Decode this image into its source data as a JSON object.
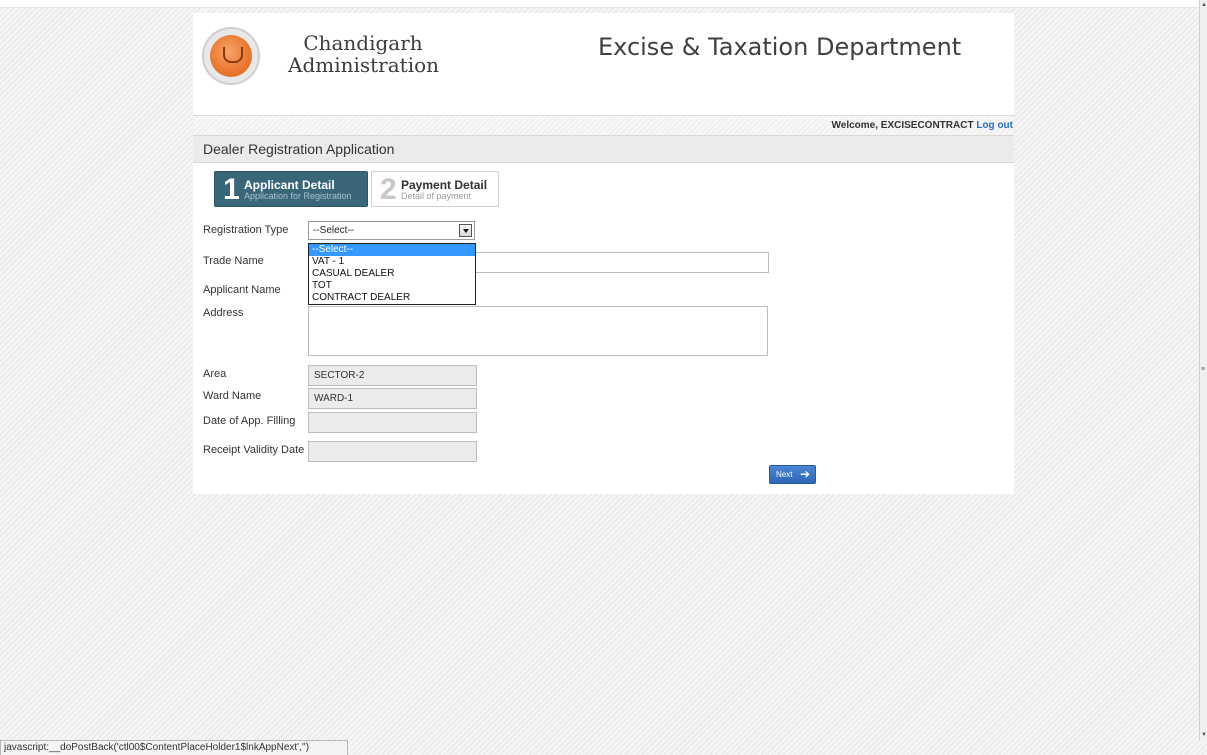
{
  "header": {
    "brand_line1": "Chandigarh",
    "brand_line2": "Administration",
    "department": "Excise & Taxation Department"
  },
  "user_bar": {
    "welcome": "Welcome, EXCISECONTRACT",
    "logout": "Log out"
  },
  "page_title": "Dealer Registration Application",
  "steps": [
    {
      "number": "1",
      "title": "Applicant Detail",
      "subtitle": "Application for Registration"
    },
    {
      "number": "2",
      "title": "Payment Detail",
      "subtitle": "Detail of payment"
    }
  ],
  "form": {
    "registration_type": {
      "label": "Registration Type",
      "value": "--Select--",
      "options": [
        "--Select--",
        "VAT - 1",
        "CASUAL DEALER",
        "TOT",
        "CONTRACT DEALER"
      ]
    },
    "trade_name": {
      "label": "Trade Name",
      "value": ""
    },
    "applicant_name": {
      "label": "Applicant Name",
      "value": ""
    },
    "address": {
      "label": "Address",
      "value": ""
    },
    "area": {
      "label": "Area",
      "value": "SECTOR-2"
    },
    "ward_name": {
      "label": "Ward Name",
      "value": "WARD-1"
    },
    "date_app_filling": {
      "label": "Date of App. Filling",
      "value": ""
    },
    "receipt_validity_date": {
      "label": "Receipt Validity Date",
      "value": ""
    }
  },
  "next_button": {
    "label": "Next",
    "icon": "arrow-right-icon"
  },
  "status_bar": "javascript:__doPostBack('ctl00$ContentPlaceHolder1$lnkAppNext','')"
}
